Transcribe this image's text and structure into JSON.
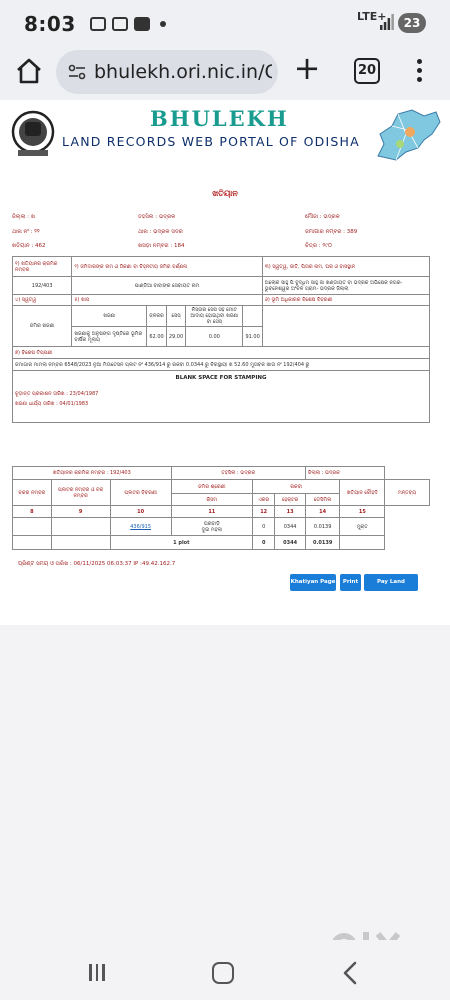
{
  "status_bar": {
    "time": "8:03",
    "network": "LTE+",
    "battery_level": "23"
  },
  "browser": {
    "url": "bhulekh.ori.nic.in/C",
    "tab_count": "20"
  },
  "header": {
    "brand": "BHULEKH",
    "portal_title": "LAND RECORDS WEB PORTAL OF ODISHA"
  },
  "document": {
    "title": "ଖତିୟାନ",
    "meta": {
      "district": "ଜିଲ୍ଲା : ଖ",
      "tahasil": "ତହସିଲ : ଭଦ୍ରକ",
      "village": "ମୌଜା : ଭଦ୍ରକ",
      "thana": "ଥାନା ନଂ : ୨୨",
      "thana_name": "ଥାନା : ଭଦ୍ରକ ସଦର",
      "ps_no": "ଜମାଗାର ନମ୍ବର : 389",
      "khatiyan_no": "ଖତିୟାନ : 462",
      "plot_no": "ଖସଡ଼ା ନମ୍ବର : 184",
      "chaka": "ଚିତ୍ର : ୨୯୦"
    },
    "t1": {
      "h1": "୧) ଖତିୟାନର କ୍ରମିକ ନମ୍ବର",
      "h2": "୨) ଜମିଦାରଙ୍କ ନାମ ଓ ଠିକଣା ବା ଚିହ୍ନଟୀୟ ଜମିର ବର୍ଣ୍ଣନା",
      "h3": "୩) ସ୍ୱତ୍ୱ, ଜାତି, ପିତାର ନାମ, ଘର ଓ ବାସସ୍ଥାନ",
      "c1": "192/403",
      "c2": "ପାଣ୍ଡିଆ ବାବାଙ୍କ ସେବାୟତ ନାମ",
      "c3": "ଅଲୋକ ସାହୁ ପି ବୁଦ୍ଧିମ ସାହୁ ଜା ଖଣ୍ଡାୟତ ବା ଭଦ୍ରକ ଅଭିଷେକ ନଗର- ଭୁବନେଶ୍ୱର ଅଂଚଳ ଗ୍ରାମ- ଭଦ୍ରକ ଜିଲ୍ଲା",
      "h4": "୪) ସ୍ୱତ୍ୱ",
      "h5": "୫) ଖାସ",
      "h6": "୬) ଭୂମି ଅଧିକାରର ବିଶେଷ ବିବରଣୀ",
      "rent_label": "ଜମିର ଖଜଣା",
      "sub_h1": "ଖଜଣା",
      "sub_h2": "ଜଳକର",
      "sub_h3": "ସେସ୍",
      "sub_h4": "ନିସ୍ତାର ସେସ ସହ ମୋଟ ଆଦାୟ ହୋଇଥିବା ଖଜଣା ବା ସେସ୍",
      "rent_desc": "ଖଜଣାକୁ ଅନୁଷଙ୍ଗ ଦୃଷ୍ଟିରେ ଭୂମିର ବାର୍ଷିକ ମୂଲ୍ୟ",
      "v1": "62.00",
      "v2": "29.00",
      "v3": "0.00",
      "v4": "91.00",
      "h7": "୭) ବିଶେଷ ଟିପ୍ପଣୀ",
      "remarks": "ଜମାଗାର ମାମଲା ନମ୍ବର 6548/2023 ନୁଆ ମିଉଟେସନ ପ୍ଲଟ ନଂ 436/914 ରୁ ରକବା 0.0344 ରୁ ଚିରସ୍ଥାୟୀ ଖ 52.60 ମୁତାବକ ଖାତା ନଂ 192/404 ରୁ",
      "blank_space": "BLANK SPACE FOR STAMPING",
      "final_pub": "ଚୂଡ଼ାନ୍ତ ପ୍ରକାଶନ ତାରିଖ : 23/04/1987",
      "tax_date": "ଖଜଣା ଧାର୍ଯ୍ୟ ତାରିଖ : 04/01/1983"
    },
    "t2": {
      "plot_block": "ଖତିୟାନର କ୍ରମିକ ନମ୍ବର : 192/403",
      "tahasil": "ତହସିଲ : ଭଦ୍ରକ",
      "district": "ଜିଲ୍ଲା : ଭଦ୍ରକ",
      "col_h8": "ଚକର ନମ୍ବର",
      "col_h9": "ପ୍ଲଟର ନମ୍ବର ଓ ଚକ ନମ୍ବର",
      "col_h10": "ପ୍ଲଟର ବିବରଣୀ",
      "col_h11": "ଜମିର ଶ୍ରେଣୀ",
      "col_h11_sub": "କିସମ",
      "col_area": "ରକବା",
      "col_h12": "ଏକର",
      "col_h13": "ହେକ୍ଟର",
      "col_h13b": "ଡେସିମିଲ",
      "col_h14": "ଖତିୟାନ ଚୌହଦି",
      "col_h15": "ମନ୍ତବ୍ୟ",
      "nums": [
        "8",
        "9",
        "10",
        "11",
        "12",
        "13",
        "14",
        "15"
      ],
      "row_plot": "436/915",
      "row_kism": "ଘରବାଡ଼ି",
      "row_kism_sub": "ଦୁଇ ମହଲା",
      "row_acre": "0",
      "row_hec": "0344",
      "row_dec": "0.0139",
      "row_rem": "ମୁକ୍ତ",
      "total_label": "1 plot",
      "total_acre": "0",
      "total_hec": "0344",
      "total_dec": "0.0139"
    },
    "timestamp": "ପ୍ରିଣ୍ଟ ସମୟ ଓ ତାରିଖ : 06/11/2025 06:03:37 IP :49.42.162.7"
  },
  "buttons": {
    "khatiyan": "Khatiyan Page",
    "print": "Print",
    "pay": "Pay Land Revenue"
  },
  "colors": {
    "accent_blue": "#1a7ed8",
    "label_red": "#a02020",
    "brand_teal": "#1a9b8f"
  }
}
